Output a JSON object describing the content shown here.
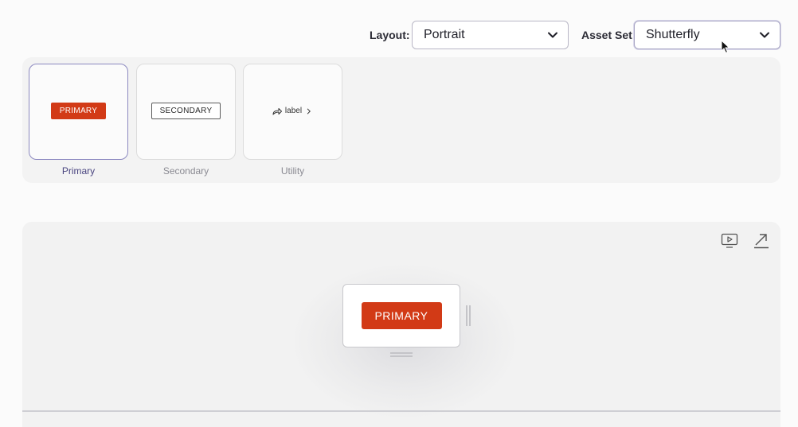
{
  "toolbar": {
    "layout_label": "Layout:",
    "layout_value": "Portrait",
    "asset_set_label": "Asset Set:",
    "asset_set_value": "Shutterfly"
  },
  "variants": {
    "selected": "Primary",
    "items": [
      {
        "label": "Primary",
        "thumbnail_text": "PRIMARY"
      },
      {
        "label": "Secondary",
        "thumbnail_text": "SECONDARY"
      },
      {
        "label": "Utility",
        "thumbnail_text": "label"
      }
    ]
  },
  "preview": {
    "button_label": "PRIMARY",
    "icons": [
      "play-preview-icon",
      "open-external-icon"
    ]
  },
  "colors": {
    "accent": "#d23a16",
    "selected_border": "#8c89c0",
    "panel_bg": "#f3f3f3"
  }
}
